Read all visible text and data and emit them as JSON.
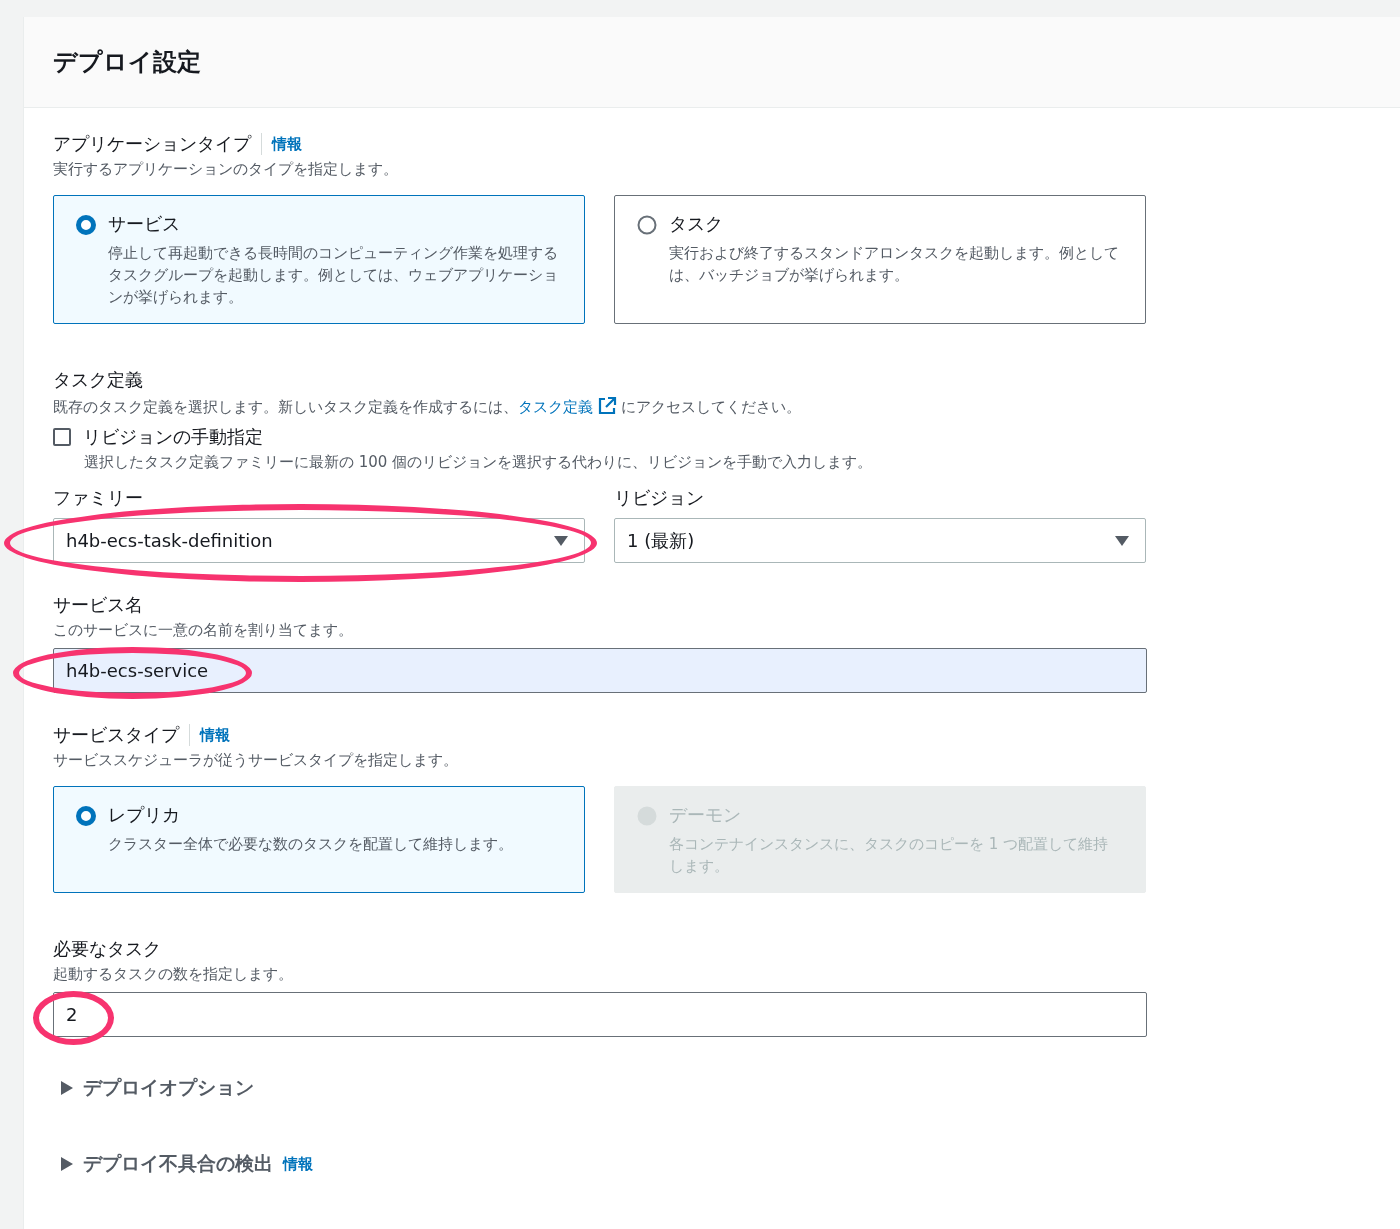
{
  "section": {
    "title": "デプロイ設定"
  },
  "application_type": {
    "label": "アプリケーションタイプ",
    "info": "情報",
    "description": "実行するアプリケーションのタイプを指定します。",
    "options": [
      {
        "title": "サービス",
        "description": "停止して再起動できる長時間のコンピューティング作業を処理するタスクグループを起動します。例としては、ウェブアプリケーションが挙げられます。",
        "selected": true,
        "disabled": false
      },
      {
        "title": "タスク",
        "description": "実行および終了するスタンドアロンタスクを起動します。例としては、バッチジョブが挙げられます。",
        "selected": false,
        "disabled": false
      }
    ]
  },
  "task_definition": {
    "label": "タスク定義",
    "description_before": "既存のタスク定義を選択します。新しいタスク定義を作成するには、",
    "link": "タスク定義",
    "description_after": "にアクセスしてください。",
    "manual_revision": {
      "label": "リビジョンの手動指定",
      "description": "選択したタスク定義ファミリーに最新の 100 個のリビジョンを選択する代わりに、リビジョンを手動で入力します。",
      "checked": false
    },
    "family": {
      "label": "ファミリー",
      "value": "h4b-ecs-task-definition",
      "highlighted": true
    },
    "revision": {
      "label": "リビジョン",
      "value": "1 (最新)"
    }
  },
  "service_name": {
    "label": "サービス名",
    "description": "このサービスに一意の名前を割り当てます。",
    "value": "h4b-ecs-service",
    "autofilled": true,
    "highlighted": true
  },
  "service_type": {
    "label": "サービスタイプ",
    "info": "情報",
    "description": "サービススケジューラが従うサービスタイプを指定します。",
    "options": [
      {
        "title": "レプリカ",
        "description": "クラスター全体で必要な数のタスクを配置して維持します。",
        "selected": true,
        "disabled": false
      },
      {
        "title": "デーモン",
        "description": "各コンテナインスタンスに、タスクのコピーを 1 つ配置して維持します。",
        "selected": false,
        "disabled": true
      }
    ]
  },
  "desired_tasks": {
    "label": "必要なタスク",
    "description": "起動するタスクの数を指定します。",
    "value": "2",
    "autofilled": false,
    "highlighted": true
  },
  "expanders": [
    {
      "label": "デプロイオプション",
      "expanded": false
    },
    {
      "label": "デプロイ不具合の検出",
      "info": "情報",
      "expanded": false
    }
  ]
}
